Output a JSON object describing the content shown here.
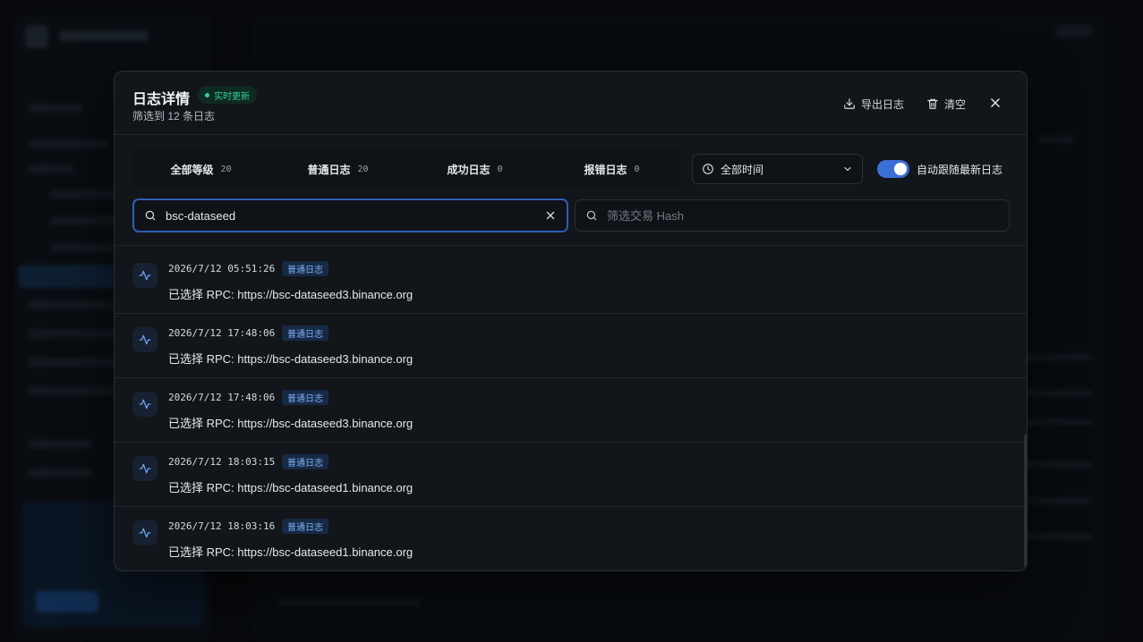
{
  "modal": {
    "title": "日志详情",
    "live_badge": "实时更新",
    "subtitle": "筛选到 12 条日志",
    "export_label": "导出日志",
    "clear_label": "清空"
  },
  "levels": [
    {
      "label": "全部等级",
      "count": "20"
    },
    {
      "label": "普通日志",
      "count": "20"
    },
    {
      "label": "成功日志",
      "count": "0"
    },
    {
      "label": "报错日志",
      "count": "0"
    }
  ],
  "time_filter": {
    "selected": "全部时间"
  },
  "auto_follow": {
    "label": "自动跟随最新日志",
    "enabled": true
  },
  "search": {
    "value": "bsc-dataseed"
  },
  "hash_search": {
    "placeholder": "筛选交易 Hash"
  },
  "logs": [
    {
      "time": "2026/7/12 05:51:26",
      "tag": "普通日志",
      "message": "已选择 RPC: https://bsc-dataseed3.binance.org"
    },
    {
      "time": "2026/7/12 17:48:06",
      "tag": "普通日志",
      "message": "已选择 RPC: https://bsc-dataseed3.binance.org"
    },
    {
      "time": "2026/7/12 17:48:06",
      "tag": "普通日志",
      "message": "已选择 RPC: https://bsc-dataseed3.binance.org"
    },
    {
      "time": "2026/7/12 18:03:15",
      "tag": "普通日志",
      "message": "已选择 RPC: https://bsc-dataseed1.binance.org"
    },
    {
      "time": "2026/7/12 18:03:16",
      "tag": "普通日志",
      "message": "已选择 RPC: https://bsc-dataseed1.binance.org"
    }
  ],
  "colors": {
    "accent": "#3b6fd6",
    "live_green": "#34d399",
    "tag_blue": "#7fb0f5"
  }
}
